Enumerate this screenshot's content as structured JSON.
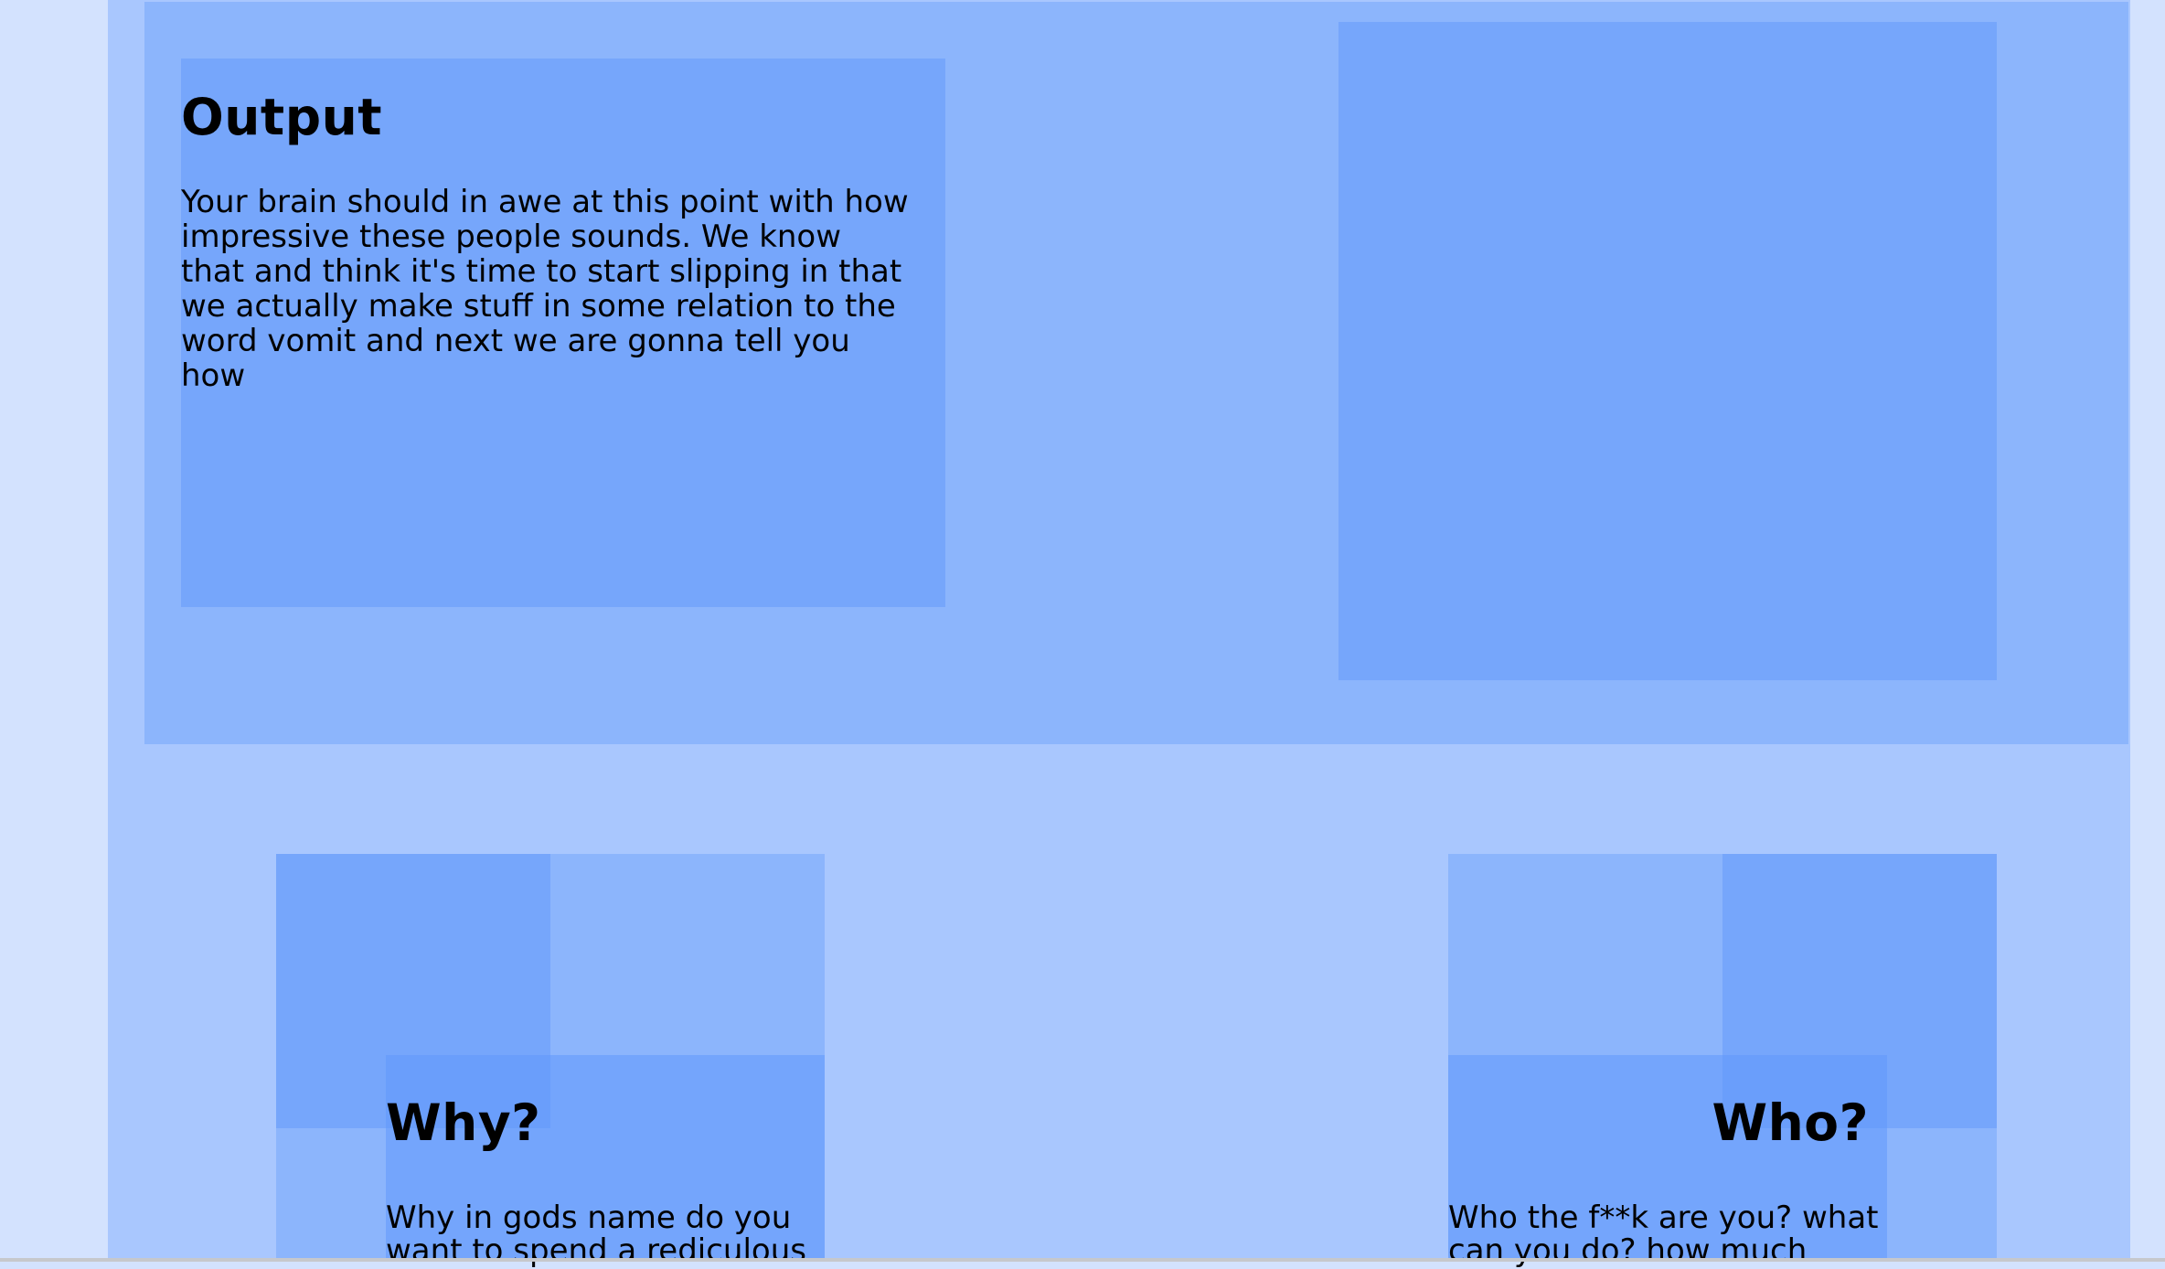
{
  "hero": {
    "title": "Output",
    "body": "Your brain should in awe at this point with how impressive these people sounds. We know that and think it's time to start slipping in that we actually make stuff in some relation to the word vomit and next we are gonna tell you how"
  },
  "cards": {
    "why": {
      "title": "Why?",
      "body": "Why in gods name do you want to spend a rediculous"
    },
    "who": {
      "title": "Who?",
      "body": "Who the f**k are you? what can you do? how much"
    }
  },
  "colors": {
    "page_margin": "#d3e2fe",
    "main_column": "#a9c7fe",
    "band": "#8cb5fc",
    "block": "#76a6fb",
    "overlay": "#6098fc",
    "text": "#000000"
  }
}
